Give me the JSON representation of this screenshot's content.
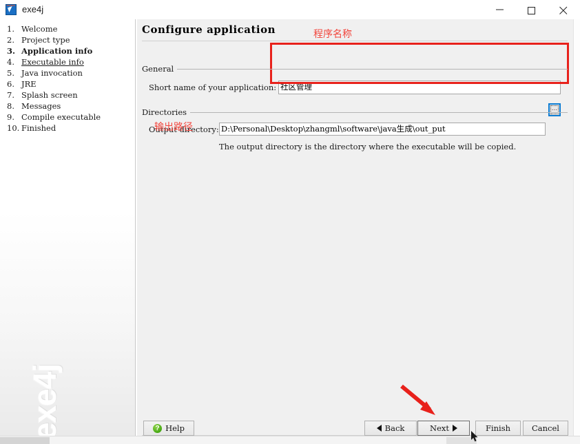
{
  "window": {
    "title": "exe4j",
    "icon": "exe4j-app-icon",
    "controls": {
      "minimize": "minimize-icon",
      "maximize": "maximize-icon",
      "close": "close-icon"
    }
  },
  "sidebar": {
    "watermark": "exe4j",
    "steps": [
      {
        "num": "1.",
        "label": "Welcome",
        "state": "normal"
      },
      {
        "num": "2.",
        "label": "Project type",
        "state": "normal"
      },
      {
        "num": "3.",
        "label": "Application info",
        "state": "current"
      },
      {
        "num": "4.",
        "label": "Executable info",
        "state": "link"
      },
      {
        "num": "5.",
        "label": "Java invocation",
        "state": "normal"
      },
      {
        "num": "6.",
        "label": "JRE",
        "state": "normal"
      },
      {
        "num": "7.",
        "label": "Splash screen",
        "state": "normal"
      },
      {
        "num": "8.",
        "label": "Messages",
        "state": "normal"
      },
      {
        "num": "9.",
        "label": "Compile executable",
        "state": "normal"
      },
      {
        "num": "10.",
        "label": "Finished",
        "state": "normal"
      }
    ]
  },
  "main": {
    "heading": "Configure application",
    "general": {
      "group_title": "General",
      "short_name_label": "Short name of your application:",
      "short_name_value": "社区管理"
    },
    "directories": {
      "group_title": "Directories",
      "output_dir_label": "Output directory:",
      "output_dir_value": "D:\\Personal\\Desktop\\zhangml\\software\\java生成\\out_put",
      "browse_button_label": "...",
      "hint": "The output directory is the directory where the executable will be copied."
    }
  },
  "buttons": {
    "help": "Help",
    "back": "Back",
    "next": "Next",
    "finish": "Finish",
    "cancel": "Cancel"
  },
  "annotations": {
    "program_name": "程序名称",
    "output_path": "输出路径",
    "box_color": "#e8211b",
    "text_color": "#f2453c",
    "arrow_color": "#e8211b"
  }
}
